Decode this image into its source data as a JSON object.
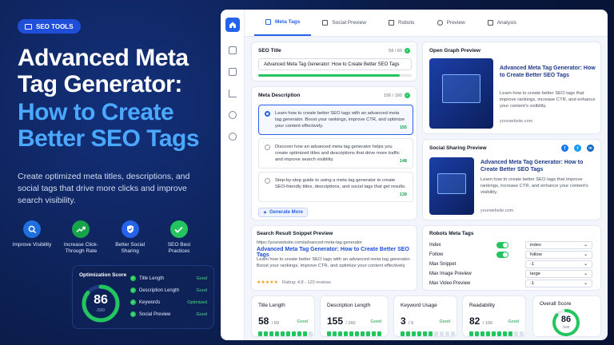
{
  "badge": "SEO TOOLS",
  "headline_1": "Advanced Meta Tag Generator:",
  "headline_2": "How to Create Better SEO Tags",
  "subtitle": "Create optimized meta titles, descriptions, and social tags that drive more clicks and improve search visibility.",
  "features": [
    {
      "label": "Improve Visibility",
      "icon": "search-icon",
      "color": "#1f6fe0"
    },
    {
      "label": "Increase Click-Through Rate",
      "icon": "trend-up-icon",
      "color": "#16a34a"
    },
    {
      "label": "Better Social Sharing",
      "icon": "shield-icon",
      "color": "#2563eb"
    },
    {
      "label": "SEO Best Practices",
      "icon": "check-icon",
      "color": "#22c55e"
    }
  ],
  "optimization": {
    "title": "Optimization Score",
    "score": "86",
    "out_of": "/100",
    "score_value": 86,
    "rows": [
      {
        "label": "Title Length",
        "status": "Good"
      },
      {
        "label": "Description Length",
        "status": "Good"
      },
      {
        "label": "Keywords",
        "status": "Optimized"
      },
      {
        "label": "Social Preview",
        "status": "Good"
      }
    ]
  },
  "tabs": [
    "Meta Tags",
    "Social Preview",
    "Robots",
    "Preview",
    "Analysis"
  ],
  "seo_title": {
    "label": "SEO Title",
    "count": "58 / 60",
    "value": "Advanced Meta Tag Generator: How to Create Better SEO Tags",
    "fill": 0.92
  },
  "meta_description": {
    "label": "Meta Description",
    "count": "156 / 160",
    "options": [
      {
        "text": "Learn how to create better SEO tags with an advanced meta tag generator. Boost your rankings, improve CTR, and optimize your content effectively.",
        "count": "155",
        "selected": true
      },
      {
        "text": "Discover how an advanced meta tag generator helps you create optimized titles and descriptions that drive more traffic and improve search visibility.",
        "count": "148",
        "selected": false
      },
      {
        "text": "Step-by-step guide to using a meta tag generator to create SEO-friendly titles, descriptions, and social tags that get results.",
        "count": "139",
        "selected": false
      }
    ],
    "generate_label": "Generate More"
  },
  "og_preview": {
    "label": "Open Graph Preview",
    "title": "Advanced Meta Tag Generator: How to Create Better SEO Tags",
    "desc": "Learn how to create better SEO tags that improve rankings, increase CTR, and enhance your content's visibility.",
    "domain": "yourwebsite.com"
  },
  "social_preview": {
    "label": "Social Sharing Preview",
    "title": "Advanced Meta Tag Generator: How to Create Better SEO Tags",
    "desc": "Learn how to create better SEO tags that improve rankings, increase CTR, and enhance your content's visibility.",
    "domain": "yourwebsite.com",
    "networks": [
      {
        "name": "facebook-icon",
        "glyph": "f",
        "color": "#1877f2"
      },
      {
        "name": "twitter-icon",
        "glyph": "t",
        "color": "#1d9bf0"
      },
      {
        "name": "linkedin-icon",
        "glyph": "in",
        "color": "#0a66c2"
      }
    ]
  },
  "serp": {
    "label": "Search Result Snippet Preview",
    "url": "https://yourwebsite.com/advanced-meta-tag-generator",
    "title": "Advanced Meta Tag Generator: How to Create Better SEO Tags",
    "desc": "Learn how to create better SEO tags with an advanced meta tag generator. Boost your rankings, improve CTR, and optimize your content effectively.",
    "rating": "Rating: 4.8 - 120 reviews",
    "stars": "★★★★★"
  },
  "robots": {
    "label": "Robots Meta Tags",
    "rows": [
      {
        "label": "Index",
        "value": "index",
        "toggle": true
      },
      {
        "label": "Follow",
        "value": "follow",
        "toggle": true
      },
      {
        "label": "Max Snippet",
        "value": "-1",
        "toggle": false
      },
      {
        "label": "Max Image Preview",
        "value": "large",
        "toggle": false
      },
      {
        "label": "Max Video Preview",
        "value": "-1",
        "toggle": false
      }
    ]
  },
  "metrics": [
    {
      "label": "Title Length",
      "value": "58",
      "unit": "/ 60",
      "status": "Good",
      "filled": 9,
      "total": 10
    },
    {
      "label": "Description Length",
      "value": "155",
      "unit": "/ 160",
      "status": "Good",
      "filled": 10,
      "total": 10
    },
    {
      "label": "Keyword Usage",
      "value": "3",
      "unit": "/ 5",
      "status": "Good",
      "filled": 6,
      "total": 10
    },
    {
      "label": "Readability",
      "value": "82",
      "unit": "/ 100",
      "status": "Good",
      "filled": 8,
      "total": 10
    }
  ],
  "overall": {
    "label": "Overall Score",
    "score": "86",
    "out_of": "/100",
    "score_value": 86
  }
}
